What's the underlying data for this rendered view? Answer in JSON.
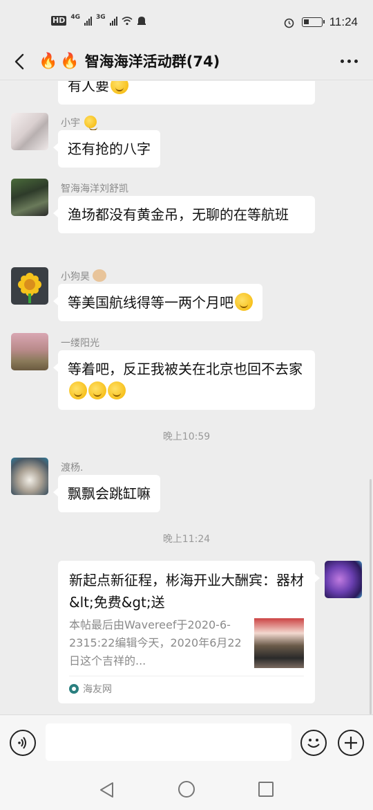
{
  "status_bar": {
    "hd": "HD",
    "net1": "4G",
    "net2": "3G",
    "time": "11:24"
  },
  "header": {
    "fire_icon": "🔥",
    "title": "智海海洋活动群(74)"
  },
  "messages": [
    {
      "nick": "",
      "text": "有人要",
      "emoji": true
    },
    {
      "nick": "小宇",
      "text": "还有抢的八字"
    },
    {
      "nick": "智海海洋刘舒凯",
      "text": "渔场都没有黄金吊，无聊的在等航班"
    },
    {
      "nick": "小狗昊",
      "text": "等美国航线得等一两个月吧"
    },
    {
      "nick": "一缕阳光",
      "text": "等着吧，反正我被关在北京也回不去家"
    },
    {
      "nick": "渡杨.",
      "text": "飘飘会跳缸嘛"
    }
  ],
  "timestamps": [
    "晚上10:59",
    "晚上11:24"
  ],
  "link_card": {
    "title": "新起点新征程，彬海开业大酬宾：器材&lt;免费&gt;送",
    "description": "本帖最后由Wavereef于2020-6-2315:22编辑今天，2020年6月22日这个吉祥的...",
    "source": "海友网"
  },
  "colors": {
    "background": "#ededed",
    "bubble": "#ffffff",
    "meta_text": "#8a8a8a"
  },
  "icons": {
    "back": "chevron-left-icon",
    "more": "more-dots-icon",
    "voice": "voice-icon",
    "emoji": "emoji-icon",
    "plus": "plus-icon"
  }
}
